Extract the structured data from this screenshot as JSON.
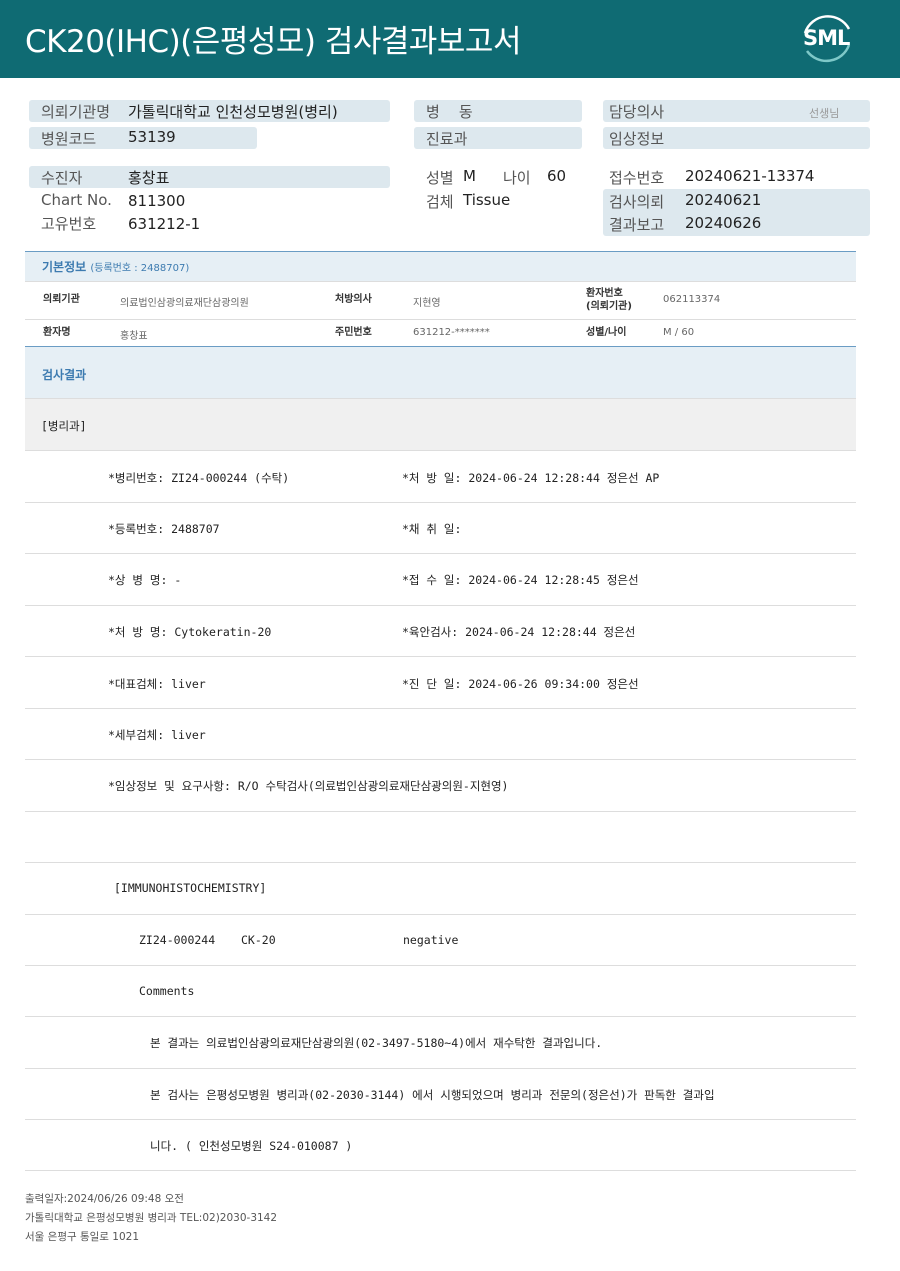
{
  "header": {
    "title": "CK20(IHC)(은평성모) 검사결과보고서",
    "logo_text": "SML",
    "bg_color": "#0f6b73"
  },
  "patient_card": {
    "institution_label": "의뢰기관명",
    "institution_value": "가톨릭대학교 인천성모병원(병리)",
    "hospital_code_label": "병원코드",
    "hospital_code_value": "53139",
    "ward_label": "병    동",
    "department_label": "진료과",
    "doctor_label": "담당의사",
    "doctor_suffix": "선생님",
    "clinical_info_label": "임상정보",
    "patient_label": "수진자",
    "patient_value": "홍창표",
    "chart_no_label": "Chart No.",
    "chart_no_value": "811300",
    "unique_no_label": "고유번호",
    "unique_no_value": "631212-1",
    "sex_label": "성별",
    "sex_value": "M",
    "age_label": "나이",
    "age_value": "60",
    "specimen_label": "검체",
    "specimen_value": "Tissue",
    "receipt_no_label": "접수번호",
    "receipt_no_value": "20240621-13374",
    "request_date_label": "검사의뢰",
    "request_date_value": "20240621",
    "report_date_label": "결과보고",
    "report_date_value": "20240626"
  },
  "basic_info": {
    "title": "기본정보",
    "reg_label": "(등록번호 : 2488707)",
    "req_inst_label": "의뢰기관",
    "req_inst_value": "의료법인삼광의료재단삼광의원",
    "presc_doctor_label": "처방의사",
    "presc_doctor_value": "지현영",
    "pt_no_label_1": "환자번호",
    "pt_no_label_2": "(의뢰기관)",
    "pt_no_value": "062113374",
    "pt_name_label": "환자명",
    "pt_name_value": "홍창표",
    "rrn_label": "주민번호",
    "rrn_value": "631212-*******",
    "sex_age_label": "성별/나이",
    "sex_age_value": "M / 60"
  },
  "results": {
    "title": "검사결과",
    "dept": "[병리과]",
    "path_no": "*병리번호: ZI24-000244 (수탁)",
    "presc_date": "*처 방 일: 2024-06-24 12:28:44  정은선 AP",
    "reg_no": "*등록번호: 2488707",
    "collect_date": "*채 취 일:",
    "disease": "*상 병 명: -",
    "receipt_date": "*접 수 일: 2024-06-24 12:28:45  정은선",
    "presc_name": "*처 방 명: Cytokeratin-20",
    "gross_exam": "*육안검사: 2024-06-24 12:28:44  정은선",
    "rep_specimen": "*대표검체: liver",
    "diag_date": "*진 단 일: 2024-06-26 09:34:00  정은선",
    "sub_specimen": "*세부검체: liver",
    "clinical_req": "*임상정보 및 요구사항: R/O 수탁검사(의료법인삼광의료재단삼광의원-지현영)",
    "ihc_header": "[IMMUNOHISTOCHEMISTRY]",
    "ihc_case": "ZI24-000244",
    "ihc_marker": "CK-20",
    "ihc_result": "negative",
    "comments_label": "Comments",
    "comment_1": "본 결과는 의료법인삼광의료재단삼광의원(02-3497-5180~4)에서 재수탁한 결과입니다.",
    "comment_2": "본 검사는 은평성모병원 병리과(02-2030-3144) 에서 시행되었으며 병리과 전문의(정은선)가 판독한 결과입",
    "comment_3": "니다. ( 인천성모병원 S24-010087 )"
  },
  "footer": {
    "print_date": "출력일자:2024/06/26 09:48 오전",
    "dept_line": "가톨릭대학교 은평성모병원 병리과 TEL:02)2030-3142",
    "address": "서울 은평구 통일로 1021"
  }
}
